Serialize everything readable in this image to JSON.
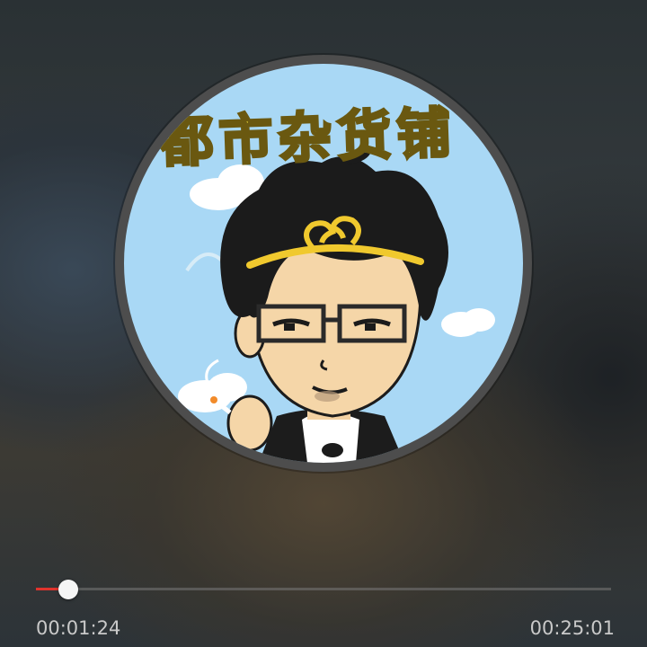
{
  "player": {
    "album_art": {
      "title_text": "都市杂货铺",
      "icon": "cartoon-avatar-album-art"
    },
    "progress": {
      "current_time": "00:01:24",
      "total_time": "00:25:01",
      "fraction": 0.056
    },
    "colors": {
      "played": "#e0332d",
      "track": "#787878",
      "thumb": "#f5f5f5",
      "sky": "#a9d8f5",
      "title": "#f3e23b"
    }
  }
}
